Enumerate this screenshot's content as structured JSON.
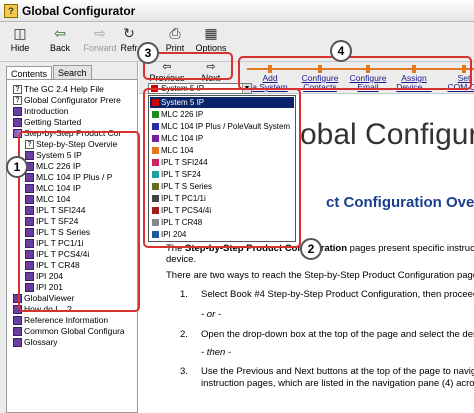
{
  "window": {
    "title": "Global Configurator",
    "app_icon": "?"
  },
  "toolbar": {
    "hide": "Hide",
    "back": "Back",
    "forward": "Forward",
    "refresh": "Refr",
    "print": "Print",
    "options": "Options"
  },
  "leftpane": {
    "tabs": [
      "Contents",
      "Search"
    ],
    "tree": [
      {
        "label": "The GC 2.4 Help File",
        "icon": "doc"
      },
      {
        "label": "Global Configurator Prere",
        "icon": "doc"
      },
      {
        "label": "Introduction",
        "icon": "book"
      },
      {
        "label": "Getting Started",
        "icon": "book"
      },
      {
        "label": "Step-by-Step Product Cor",
        "icon": "bookopen"
      },
      {
        "label": "Step-by-Step Overvie",
        "icon": "doc"
      },
      {
        "label": "System 5 IP",
        "icon": "book"
      },
      {
        "label": "MLC 226 IP",
        "icon": "book"
      },
      {
        "label": "MLC 104 IP Plus / P",
        "icon": "book"
      },
      {
        "label": "MLC 104 IP",
        "icon": "book"
      },
      {
        "label": "MLC 104",
        "icon": "book"
      },
      {
        "label": "IPL T SFI244",
        "icon": "book"
      },
      {
        "label": "IPL T SF24",
        "icon": "book"
      },
      {
        "label": "IPL T S Series",
        "icon": "book"
      },
      {
        "label": "IPL T PC1/1i",
        "icon": "book"
      },
      {
        "label": "IPL T PCS4/4i",
        "icon": "book"
      },
      {
        "label": "IPL T CR48",
        "icon": "book"
      },
      {
        "label": "IPI 204",
        "icon": "book"
      },
      {
        "label": "IPI 201",
        "icon": "book"
      },
      {
        "label": "GlobalViewer",
        "icon": "book"
      },
      {
        "label": "How do I....?",
        "icon": "book"
      },
      {
        "label": "Reference Information",
        "icon": "book"
      },
      {
        "label": "Common Global Configura",
        "icon": "book"
      },
      {
        "label": "Glossary",
        "icon": "book"
      }
    ]
  },
  "navbar": {
    "previous": "Previous",
    "next": "Next",
    "steps": [
      [
        "Add",
        "a System"
      ],
      [
        "Configure",
        "Contacts"
      ],
      [
        "Configure",
        "Email"
      ],
      [
        "Assign",
        "Device ..."
      ],
      [
        "Set",
        "COM Co"
      ]
    ]
  },
  "dropdown": {
    "selected": "System 5 IP",
    "options": [
      {
        "label": "System 5 IP",
        "color": "#cc0000"
      },
      {
        "label": "MLC 226 IP",
        "color": "#1f8a1f"
      },
      {
        "label": "MLC 104 IP Plus / PoleVault System",
        "color": "#2a2aa8"
      },
      {
        "label": "MLC 104 IP",
        "color": "#7a1fa0"
      },
      {
        "label": "MLC 104",
        "color": "#e07a1c"
      },
      {
        "label": "IPL T SFI244",
        "color": "#cc2266"
      },
      {
        "label": "IPL T SF24",
        "color": "#1fa0a0"
      },
      {
        "label": "IPL T S Series",
        "color": "#6a6a1f"
      },
      {
        "label": "IPL T PC1/1i",
        "color": "#444444"
      },
      {
        "label": "IPL T PCS4/4i",
        "color": "#a01f1f"
      },
      {
        "label": "IPL T CR48",
        "color": "#888888"
      },
      {
        "label": "IPI 204",
        "color": "#1f5aa0"
      }
    ]
  },
  "content": {
    "heading": "obal Configura",
    "subheading": "ct Configuration Over",
    "para1_pre": "The ",
    "para1_bold": "Step-by-Step Product Configuration",
    "para1_post": " pages present specific instructio",
    "para1_line2": "device.",
    "para2": "There are two ways to reach the Step-by-Step Product Configuration page",
    "step1_num": "1.",
    "step1": "Select Book #4 Step-by-Step Product Configuration, then proceed",
    "or1": "- or -",
    "step2_num": "2.",
    "step2": "Open the drop-down box at the top of the page and select the desir",
    "then": "- then -",
    "step3_num": "3.",
    "step3": "Use the Previous and Next buttons at the top of the page to navigat",
    "step3_line2": "instruction pages, which are listed in the navigation pane (4) acros"
  },
  "callouts": [
    "1",
    "2",
    "3",
    "4"
  ],
  "colors": {
    "highlight": "#d93030",
    "nav_accent": "#e07a1c",
    "selection": "#0a246a"
  }
}
